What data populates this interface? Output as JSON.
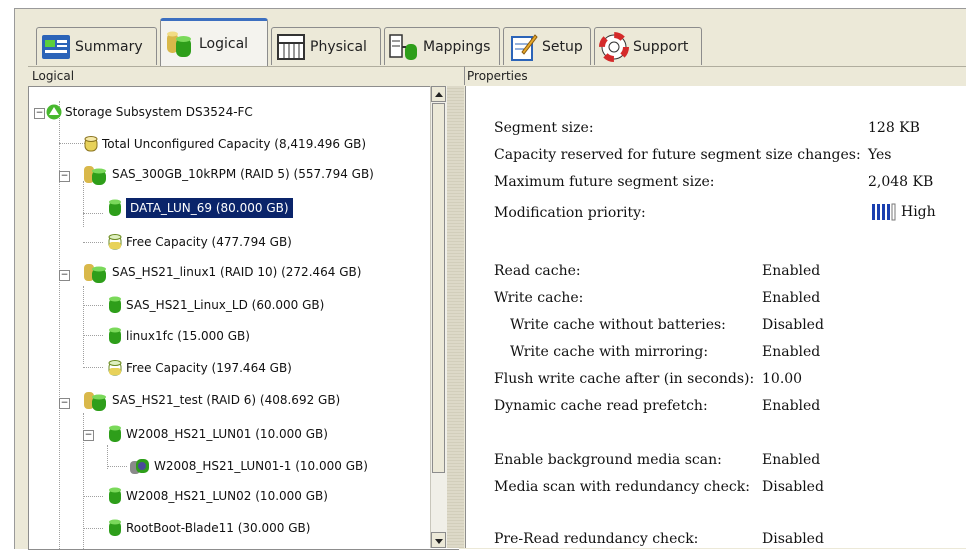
{
  "tabs": [
    {
      "label": "Summary",
      "icon": "summary-icon"
    },
    {
      "label": "Logical",
      "icon": "logical-icon",
      "active": true
    },
    {
      "label": "Physical",
      "icon": "physical-icon"
    },
    {
      "label": "Mappings",
      "icon": "mappings-icon"
    },
    {
      "label": "Setup",
      "icon": "setup-icon"
    },
    {
      "label": "Support",
      "icon": "support-icon"
    }
  ],
  "left_header": "Logical",
  "right_header": "Properties",
  "tree": [
    {
      "label": "Storage Subsystem DS3524-FC",
      "icon": "subsystem-icon"
    },
    {
      "label": "Total Unconfigured Capacity (8,419.496 GB)",
      "icon": "unconfigured-capacity-icon"
    },
    {
      "label": "SAS_300GB_10kRPM (RAID 5) (557.794 GB)",
      "icon": "array-icon"
    },
    {
      "label": "DATA_LUN_69 (80.000 GB)",
      "icon": "logical-drive-icon",
      "selected": true
    },
    {
      "label": "Free Capacity (477.794 GB)",
      "icon": "free-capacity-icon"
    },
    {
      "label": "SAS_HS21_linux1 (RAID 10) (272.464 GB)",
      "icon": "array-icon"
    },
    {
      "label": "SAS_HS21_Linux_LD (60.000 GB)",
      "icon": "logical-drive-icon"
    },
    {
      "label": "linux1fc (15.000 GB)",
      "icon": "logical-drive-icon"
    },
    {
      "label": "Free Capacity (197.464 GB)",
      "icon": "free-capacity-icon"
    },
    {
      "label": "SAS_HS21_test (RAID 6) (408.692 GB)",
      "icon": "array-icon"
    },
    {
      "label": "W2008_HS21_LUN01 (10.000 GB)",
      "icon": "logical-drive-icon"
    },
    {
      "label": "W2008_HS21_LUN01-1 (10.000 GB)",
      "icon": "flashcopy-icon"
    },
    {
      "label": "W2008_HS21_LUN02 (10.000 GB)",
      "icon": "logical-drive-icon"
    },
    {
      "label": "RootBoot-Blade11 (30.000 GB)",
      "icon": "logical-drive-icon"
    }
  ],
  "properties": [
    {
      "label": "Segment size:",
      "value": "128 KB"
    },
    {
      "label": "Capacity reserved for future segment size changes:",
      "value": "Yes"
    },
    {
      "label": "Maximum future segment size:",
      "value": "2,048 KB"
    },
    {
      "label": "Modification priority:",
      "value": "High",
      "icon": "priority-bars-icon"
    },
    {
      "label": "Read cache:",
      "value": "Enabled"
    },
    {
      "label": "Write cache:",
      "value": "Enabled"
    },
    {
      "label": "Write cache without batteries:",
      "value": "Disabled"
    },
    {
      "label": "Write cache with mirroring:",
      "value": "Enabled"
    },
    {
      "label": "Flush write cache after (in seconds):",
      "value": "10.00"
    },
    {
      "label": "Dynamic cache read prefetch:",
      "value": "Enabled"
    },
    {
      "label": "Enable background media scan:",
      "value": "Enabled"
    },
    {
      "label": "Media scan with redundancy check:",
      "value": "Disabled"
    },
    {
      "label": "Pre-Read redundancy check:",
      "value": "Disabled"
    }
  ],
  "colors": {
    "selection": "#0a246a",
    "drive_green": "#2e9e1a",
    "capacity_yellow": "#e8d25a",
    "active_tab_border": "#3c6fc0"
  }
}
